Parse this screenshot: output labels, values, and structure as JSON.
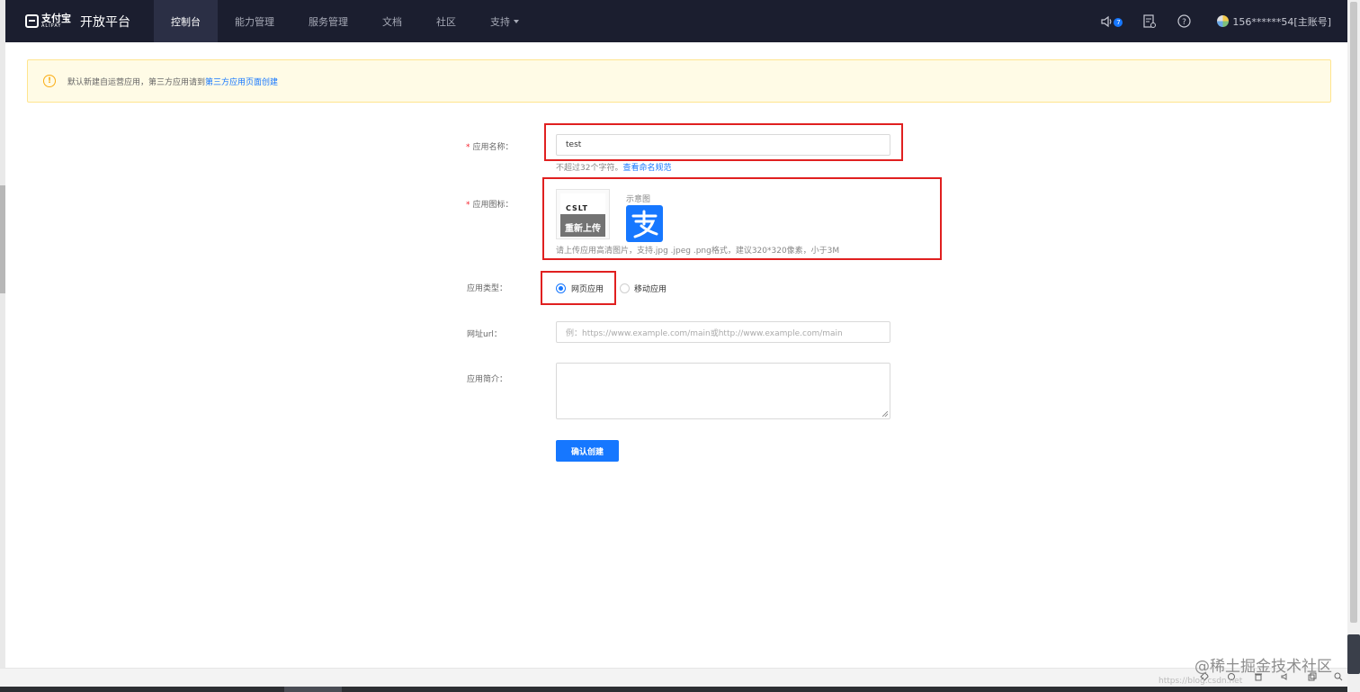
{
  "nav": {
    "brand_logo_zh": "支付宝",
    "brand_logo_en": "ALIPAY",
    "brand_title": "开放平台",
    "tabs": [
      {
        "label": "控制台",
        "active": true
      },
      {
        "label": "能力管理"
      },
      {
        "label": "服务管理"
      },
      {
        "label": "文档"
      },
      {
        "label": "社区"
      },
      {
        "label": "支持"
      }
    ],
    "notification_count": "7",
    "user_label": "156******54[主账号]",
    "icons": [
      "speaker-icon",
      "document-clock-icon",
      "help-icon",
      "avatar"
    ]
  },
  "alert": {
    "text": "默认新建自运营应用，第三方应用请到",
    "link": "第三方应用页面创建",
    "color": "#faad14"
  },
  "form": {
    "app_name": {
      "label": "应用名称：",
      "value": "test",
      "hint_prefix": "不超过32个字符。",
      "hint_link": "查看命名规范"
    },
    "app_icon": {
      "label": "应用图标：",
      "upload_overlay": "重新上传",
      "sample_label": "示意图",
      "hint": "请上传应用高清图片，支持.jpg .jpeg .png格式，建议320*320像素，小于3M"
    },
    "app_type": {
      "label": "应用类型：",
      "options": [
        {
          "label": "网页应用",
          "checked": true
        },
        {
          "label": "移动应用",
          "checked": false
        }
      ]
    },
    "url": {
      "label": "网址url：",
      "placeholder": "例：https://www.example.com/main或http://www.example.com/main"
    },
    "intro": {
      "label": "应用简介："
    },
    "submit_label": "确认创建"
  },
  "watermark": {
    "text": "@稀土掘金技术社区",
    "url": "https://blog.csdn.net"
  },
  "colors": {
    "accent": "#1677ff",
    "nav_bg": "#1b1e2f",
    "highlight": "#e02020"
  }
}
